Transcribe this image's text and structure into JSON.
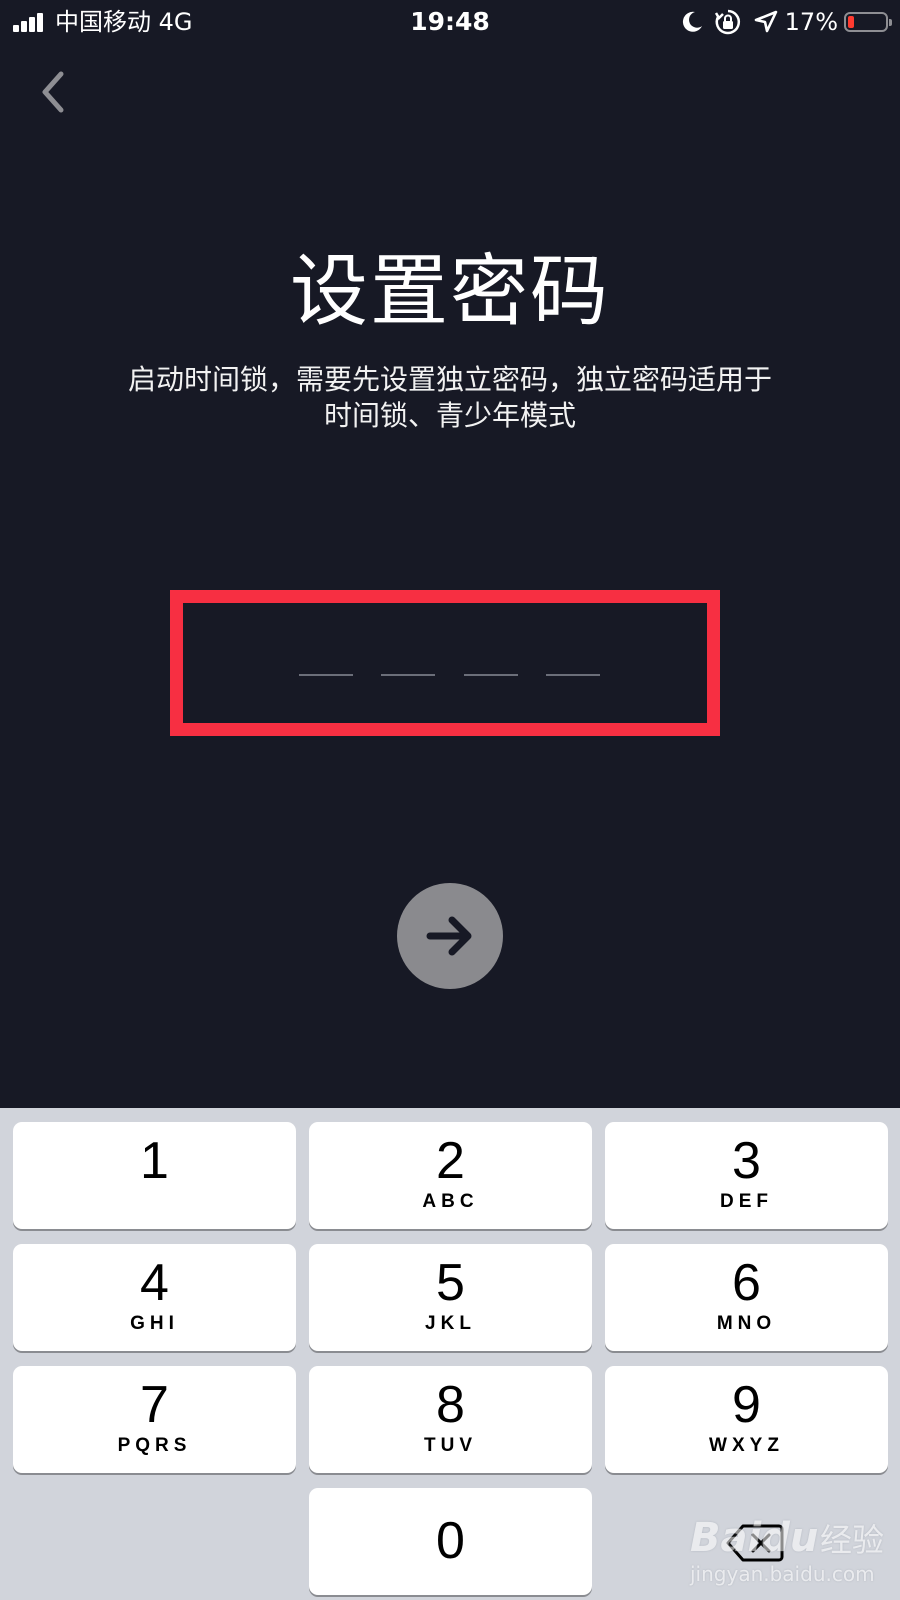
{
  "status_bar": {
    "carrier": "中国移动   4G",
    "time": "19:48",
    "battery_percent": "17%",
    "battery_level": 0.17,
    "icons": [
      "signal-icon",
      "moon-icon",
      "rotation-lock-icon",
      "location-icon",
      "battery-icon"
    ]
  },
  "nav": {
    "back_icon": "chevron-left-icon"
  },
  "header": {
    "title": "设置密码",
    "subtitle_line1": "启动时间锁，需要先设置独立密码，独立密码适用于",
    "subtitle_line2": "时间锁、青少年模式"
  },
  "passcode": {
    "length": 4,
    "highlight_color": "#f72f42"
  },
  "next_button": {
    "icon": "arrow-right-icon"
  },
  "keypad": {
    "keys": [
      {
        "num": "1",
        "letters": ""
      },
      {
        "num": "2",
        "letters": "ABC"
      },
      {
        "num": "3",
        "letters": "DEF"
      },
      {
        "num": "4",
        "letters": "GHI"
      },
      {
        "num": "5",
        "letters": "JKL"
      },
      {
        "num": "6",
        "letters": "MNO"
      },
      {
        "num": "7",
        "letters": "PQRS"
      },
      {
        "num": "8",
        "letters": "TUV"
      },
      {
        "num": "9",
        "letters": "WXYZ"
      },
      {
        "num": "0",
        "letters": ""
      }
    ],
    "delete_icon": "backspace-icon"
  },
  "watermark": {
    "brand": "Baidu",
    "product": "经验",
    "url": "jingyan.baidu.com"
  },
  "colors": {
    "background": "#171925",
    "keypad_background": "#d1d4db",
    "key_background": "#ffffff",
    "next_button": "#8a8a8e",
    "battery_low": "#ff3b30"
  }
}
